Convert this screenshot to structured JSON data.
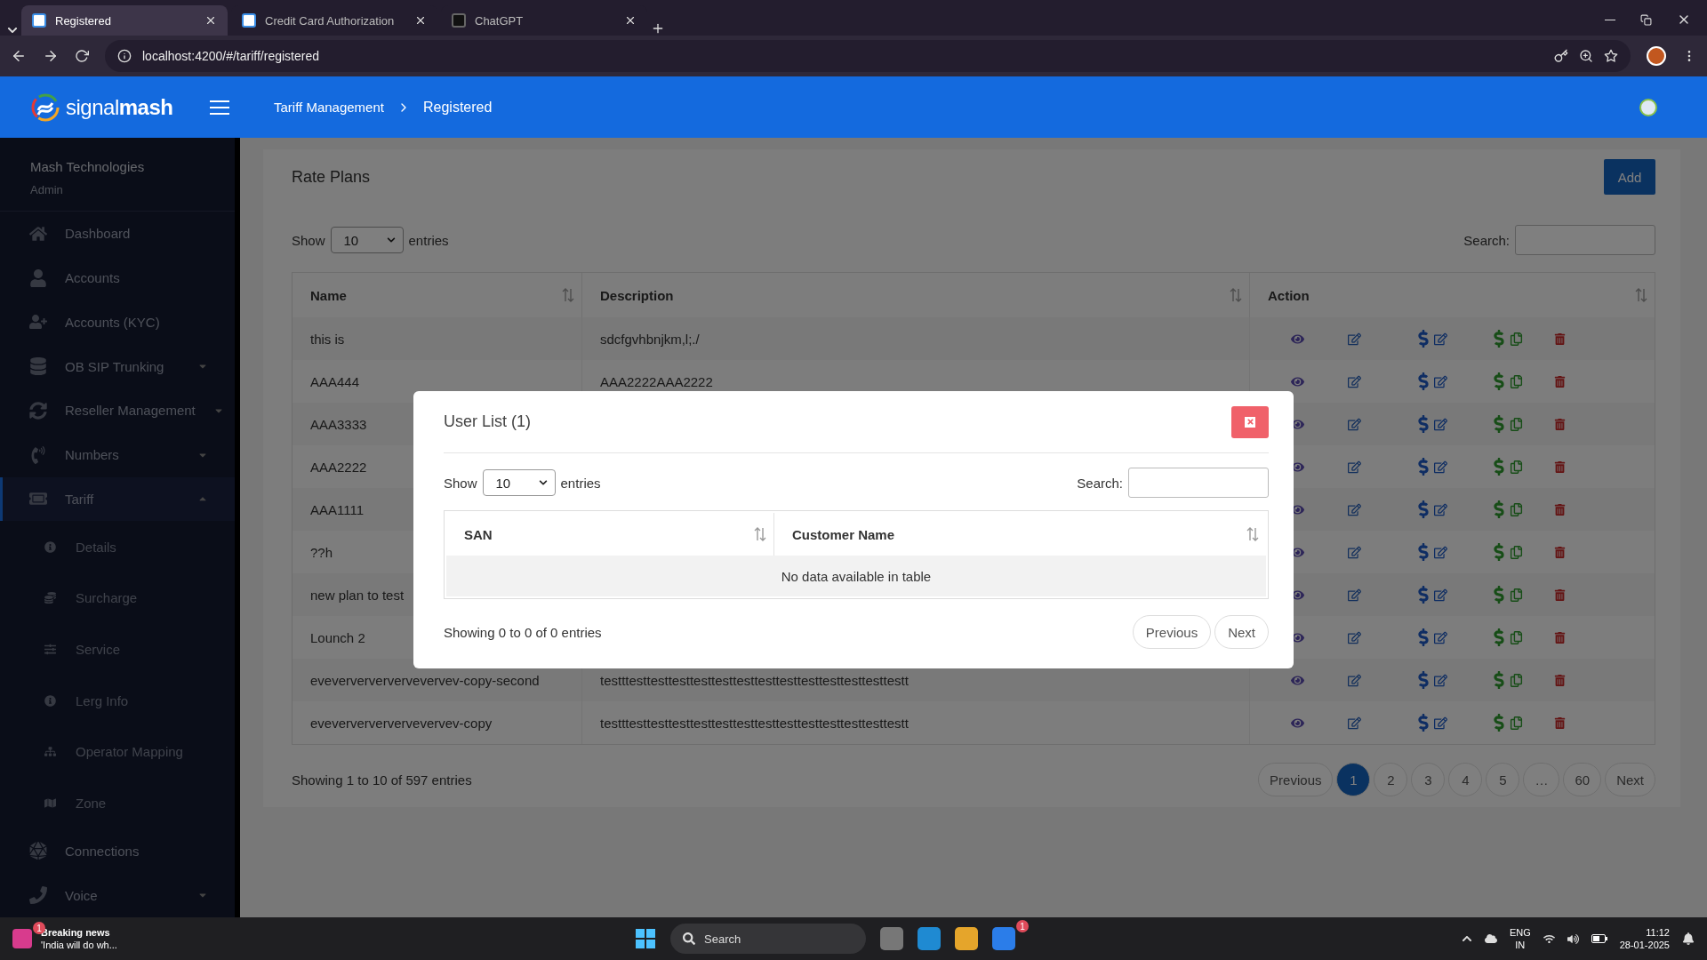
{
  "browser": {
    "tabs": [
      {
        "title": "Registered",
        "selected": true
      },
      {
        "title": "Credit Card Authorization",
        "selected": false
      },
      {
        "title": "ChatGPT",
        "selected": false
      }
    ],
    "url": "localhost:4200/#/tariff/registered"
  },
  "header": {
    "logo_light": "signal",
    "logo_bold": "mash",
    "breadcrumb": [
      "Tariff Management",
      "Registered"
    ]
  },
  "sidebar": {
    "org": "Mash Technologies",
    "role": "Admin",
    "items": [
      {
        "label": "Dashboard",
        "kind": "link",
        "selected": false
      },
      {
        "label": "Accounts",
        "kind": "link",
        "selected": false
      },
      {
        "label": "Accounts (KYC)",
        "kind": "link",
        "selected": false
      },
      {
        "label": "OB SIP Trunking",
        "kind": "dropdown",
        "selected": false,
        "expanded": false
      },
      {
        "label": "Reseller Management",
        "kind": "dropdown",
        "selected": false,
        "expanded": false
      },
      {
        "label": "Numbers",
        "kind": "dropdown",
        "selected": false,
        "expanded": false
      },
      {
        "label": "Tariff",
        "kind": "dropdown",
        "selected": true,
        "expanded": true,
        "children": [
          {
            "label": "Details"
          },
          {
            "label": "Surcharge"
          },
          {
            "label": "Service"
          },
          {
            "label": "Lerg Info"
          },
          {
            "label": "Operator Mapping"
          },
          {
            "label": "Zone"
          }
        ]
      },
      {
        "label": "Connections",
        "kind": "link",
        "selected": false
      },
      {
        "label": "Voice",
        "kind": "dropdown",
        "selected": false,
        "expanded": false
      }
    ]
  },
  "rate_plans": {
    "title": "Rate Plans",
    "add_button": "Add",
    "show_label": "Show",
    "page_length": "10",
    "entries_label": "entries",
    "search_label": "Search:",
    "columns": [
      "Name",
      "Description",
      "Action"
    ],
    "rows": [
      {
        "name": "this is",
        "description": "sdcfgvhbnjkm,l;./"
      },
      {
        "name": "AAA444",
        "description": "AAA2222AAA2222"
      },
      {
        "name": "AAA3333"
      },
      {
        "name": "AAA2222"
      },
      {
        "name": "AAA1111"
      },
      {
        "name": "??h"
      },
      {
        "name": "new plan to test"
      },
      {
        "name": "Lounch 2"
      },
      {
        "name": "eveververververvevervev-copy-second",
        "description": "testttesttesttesttesttesttesttesttesttesttesttesttesttestt"
      },
      {
        "name": "eveververververvevervev-copy",
        "description": "testttesttesttesttesttesttesttesttesttesttesttesttesttestt"
      }
    ],
    "info": "Showing 1 to 10 of 597 entries",
    "pagination": [
      {
        "label": "Previous",
        "selected": false
      },
      {
        "label": "1",
        "selected": true
      },
      {
        "label": "2",
        "selected": false
      },
      {
        "label": "3",
        "selected": false
      },
      {
        "label": "4",
        "selected": false
      },
      {
        "label": "5",
        "selected": false
      },
      {
        "label": "…",
        "selected": false
      },
      {
        "label": "60",
        "selected": false
      },
      {
        "label": "Next",
        "selected": false
      }
    ]
  },
  "modal": {
    "title": "User List (1)",
    "show_label": "Show",
    "page_length": "10",
    "entries_label": "entries",
    "search_label": "Search:",
    "columns": [
      "SAN",
      "Customer Name"
    ],
    "empty": "No data available in table",
    "info": "Showing 0 to 0 of 0 entries",
    "buttons": [
      "Previous",
      "Next"
    ]
  },
  "taskbar": {
    "news_title": "Breaking news",
    "news_text": "'India will do wh...",
    "news_badge": "1",
    "search": "Search",
    "app_badge": "1",
    "lang": "ENG",
    "region": "IN",
    "time": "11:12",
    "date": "28-01-2025"
  }
}
